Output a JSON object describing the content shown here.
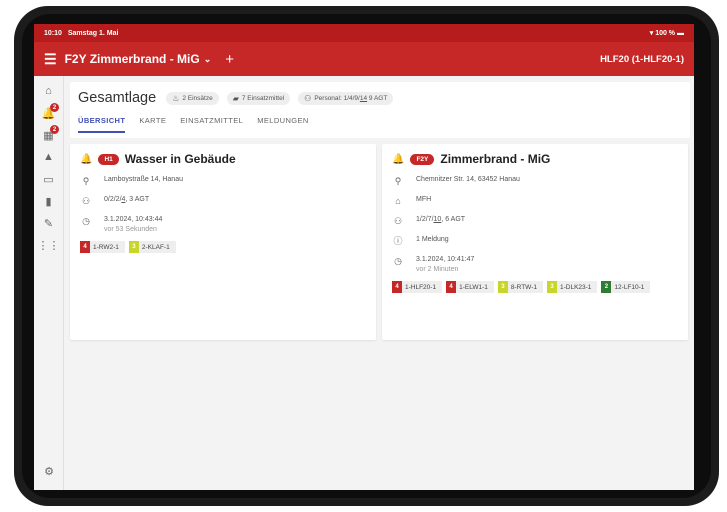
{
  "status_bar": {
    "time": "10:10",
    "date": "Samstag 1. Mai",
    "battery": "100 %"
  },
  "app_bar": {
    "title": "F2Y Zimmerbrand - MiG",
    "right": "HLF20 (1-HLF20-1)"
  },
  "rail": {
    "badge1": "2",
    "badge2": "2"
  },
  "header": {
    "title": "Gesamtlage",
    "chip_einsaetze": "2 Einsätze",
    "chip_einsatzmittel": "7 Einsatzmittel",
    "chip_personal_prefix": "Personal: 1/4/9/",
    "chip_personal_u": "14",
    "chip_personal_suffix": " 9 AGT"
  },
  "tabs": [
    "ÜBERSICHT",
    "KARTE",
    "EINSATZMITTEL",
    "MELDUNGEN"
  ],
  "card1": {
    "pill": "H1",
    "title": "Wasser in Gebäude",
    "address": "Lamboystraße 14, Hanau",
    "crew_prefix": "0/2/2/",
    "crew_u": "4",
    "crew_suffix": ", 3 AGT",
    "time": "3.1.2024, 10:43:44",
    "time_ago": "vor 53 Sekunden",
    "units": [
      {
        "num": "4",
        "label": "1-RW2-1",
        "color": "#c62828"
      },
      {
        "num": "3",
        "label": "2-KLAF-1",
        "color": "#c8d62a"
      }
    ]
  },
  "card2": {
    "pill": "F2Y",
    "title": "Zimmerbrand - MiG",
    "address": "Chemnitzer Str. 14, 63452 Hanau",
    "building": "MFH",
    "crew_prefix": "1/2/7/",
    "crew_u": "10",
    "crew_suffix": ", 6 AGT",
    "meldung": "1 Meldung",
    "time": "3.1.2024, 10:41:47",
    "time_ago": "vor 2 Minuten",
    "units": [
      {
        "num": "4",
        "label": "1-HLF20-1",
        "color": "#c62828"
      },
      {
        "num": "4",
        "label": "1-ELW1-1",
        "color": "#c62828"
      },
      {
        "num": "3",
        "label": "8-RTW-1",
        "color": "#c8d62a"
      },
      {
        "num": "3",
        "label": "1-DLK23-1",
        "color": "#c8d62a"
      },
      {
        "num": "2",
        "label": "12-LF10-1",
        "color": "#2e7d32"
      }
    ]
  }
}
